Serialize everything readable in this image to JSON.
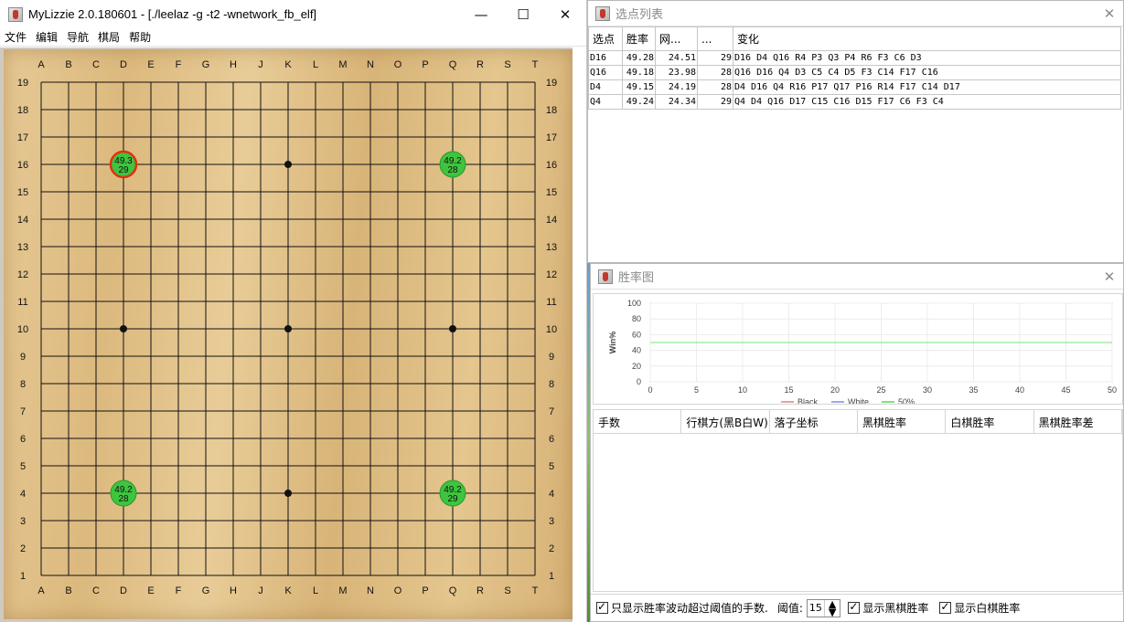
{
  "main": {
    "title": "MyLizzie 2.0.180601 - [./leelaz -g -t2 -wnetwork_fb_elf]",
    "menu": [
      "文件",
      "编辑",
      "导航",
      "棋局",
      "帮助"
    ],
    "controls": {
      "minimize": "—",
      "maximize": "☐",
      "close": "✕"
    }
  },
  "board": {
    "columns": [
      "A",
      "B",
      "C",
      "D",
      "E",
      "F",
      "G",
      "H",
      "J",
      "K",
      "L",
      "M",
      "N",
      "O",
      "P",
      "Q",
      "R",
      "S",
      "T"
    ],
    "rows": [
      "19",
      "18",
      "17",
      "16",
      "15",
      "14",
      "13",
      "12",
      "11",
      "10",
      "9",
      "8",
      "7",
      "6",
      "5",
      "4",
      "3",
      "2",
      "1"
    ],
    "star_points": [
      "D16",
      "K16",
      "Q16",
      "D10",
      "K10",
      "Q10",
      "D4",
      "K4",
      "Q4"
    ],
    "candidates": [
      {
        "move": "D16",
        "winrate": "49.3",
        "visits": "29",
        "best": true
      },
      {
        "move": "Q16",
        "winrate": "49.2",
        "visits": "28",
        "best": false
      },
      {
        "move": "D4",
        "winrate": "49.2",
        "visits": "28",
        "best": false
      },
      {
        "move": "Q4",
        "winrate": "49.2",
        "visits": "29",
        "best": false
      }
    ]
  },
  "candidate_window": {
    "title": "选点列表",
    "headers": [
      "选点",
      "胜率",
      "网...",
      "...",
      "变化"
    ],
    "rows": [
      [
        "D16",
        "49.28",
        "24.51",
        "29",
        "D16 D4 Q16 R4 P3 Q3 P4 R6 F3 C6 D3"
      ],
      [
        "Q16",
        "49.18",
        "23.98",
        "28",
        "Q16 D16 Q4 D3 C5 C4 D5 F3 C14 F17 C16"
      ],
      [
        "D4",
        "49.15",
        "24.19",
        "28",
        "D4 D16 Q4 R16 P17 Q17 P16 R14 F17 C14 D17"
      ],
      [
        "Q4",
        "49.24",
        "24.34",
        "29",
        "Q4 D4 Q16 D17 C15 C16 D15 F17 C6 F3 C4"
      ]
    ]
  },
  "winrate_window": {
    "title": "胜率图",
    "history_headers": [
      "手数",
      "行棋方(黑B白W)",
      "落子坐标",
      "黑棋胜率",
      "白棋胜率",
      "黑棋胜率差"
    ],
    "filter_label": "只显示胜率波动超过阈值的手数.",
    "threshold_label": "阈值:",
    "threshold_value": "15",
    "show_black_label": "显示黑棋胜率",
    "show_white_label": "显示白棋胜率"
  },
  "chart_data": {
    "type": "line",
    "ylabel": "Win%",
    "xlabel": "",
    "xlim": [
      0,
      50
    ],
    "ylim": [
      0,
      100
    ],
    "x_ticks": [
      "0",
      "5",
      "10",
      "15",
      "20",
      "25",
      "30",
      "35",
      "40",
      "45",
      "50"
    ],
    "y_ticks": [
      "0",
      "20",
      "40",
      "60",
      "80",
      "100"
    ],
    "series": [
      {
        "name": "Black",
        "color": "#e8a0a0",
        "values": []
      },
      {
        "name": "White",
        "color": "#a0a8e8",
        "values": []
      },
      {
        "name": "50%",
        "color": "#7ee07e",
        "values": [
          [
            0,
            50
          ],
          [
            50,
            50
          ]
        ]
      }
    ],
    "grid": true,
    "legend": "bottom"
  }
}
